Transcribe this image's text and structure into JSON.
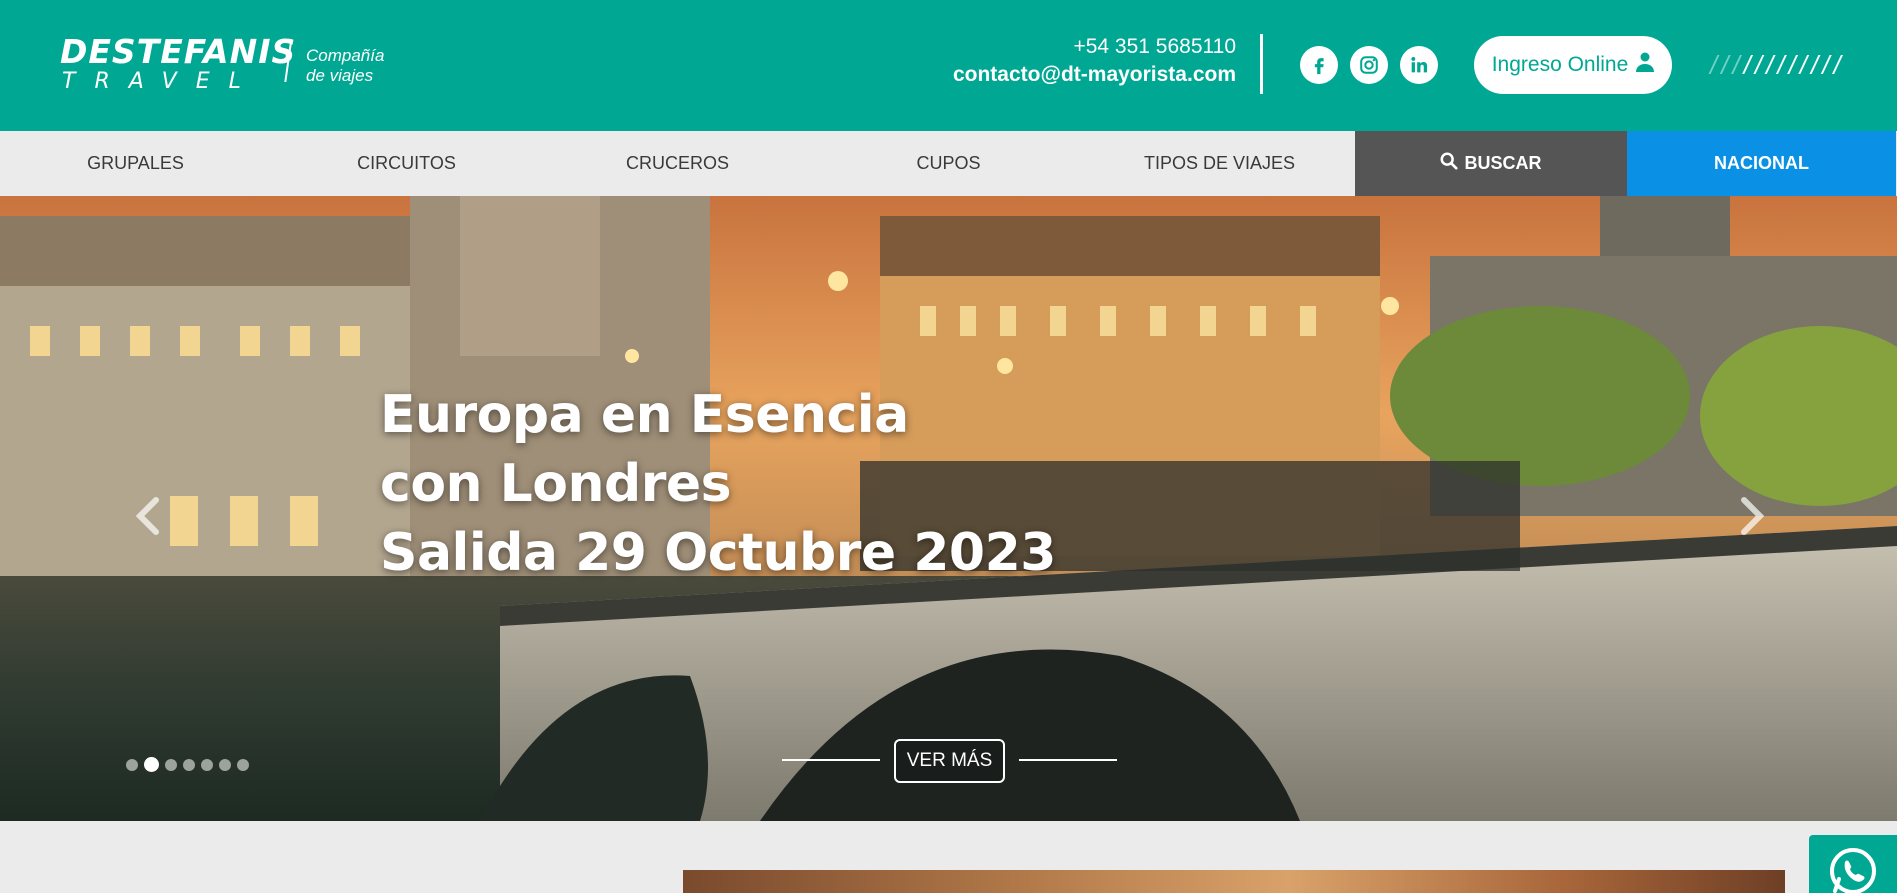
{
  "brand": {
    "name_line1": "DESTEFANIS",
    "name_line2": "TRAVEL",
    "tagline_line1": "Compañía",
    "tagline_line2": "de viajes"
  },
  "contact": {
    "phone": "+54 351 5685110",
    "email": "contacto@dt-mayorista.com"
  },
  "social": [
    "facebook-icon",
    "instagram-icon",
    "linkedin-icon"
  ],
  "login": {
    "label": "Ingreso Online",
    "icon": "user-icon"
  },
  "nav": {
    "items": [
      {
        "label": "GRUPALES"
      },
      {
        "label": "CIRCUITOS"
      },
      {
        "label": "CRUCEROS"
      },
      {
        "label": "CUPOS"
      },
      {
        "label": "TIPOS DE VIAJES"
      }
    ],
    "search_label": "BUSCAR",
    "nacional_label": "NACIONAL"
  },
  "hero": {
    "title_line1": "Europa en Esencia",
    "title_line2": "con Londres",
    "title_line3": "Salida 29 Octubre 2023",
    "cta_label": "VER MÁS",
    "slide_count": 7,
    "active_slide": 2
  },
  "colors": {
    "brand_teal": "#00a894",
    "nav_bg": "#ebebeb",
    "search_bg": "#555555",
    "nacional_bg": "#0a91e6"
  }
}
